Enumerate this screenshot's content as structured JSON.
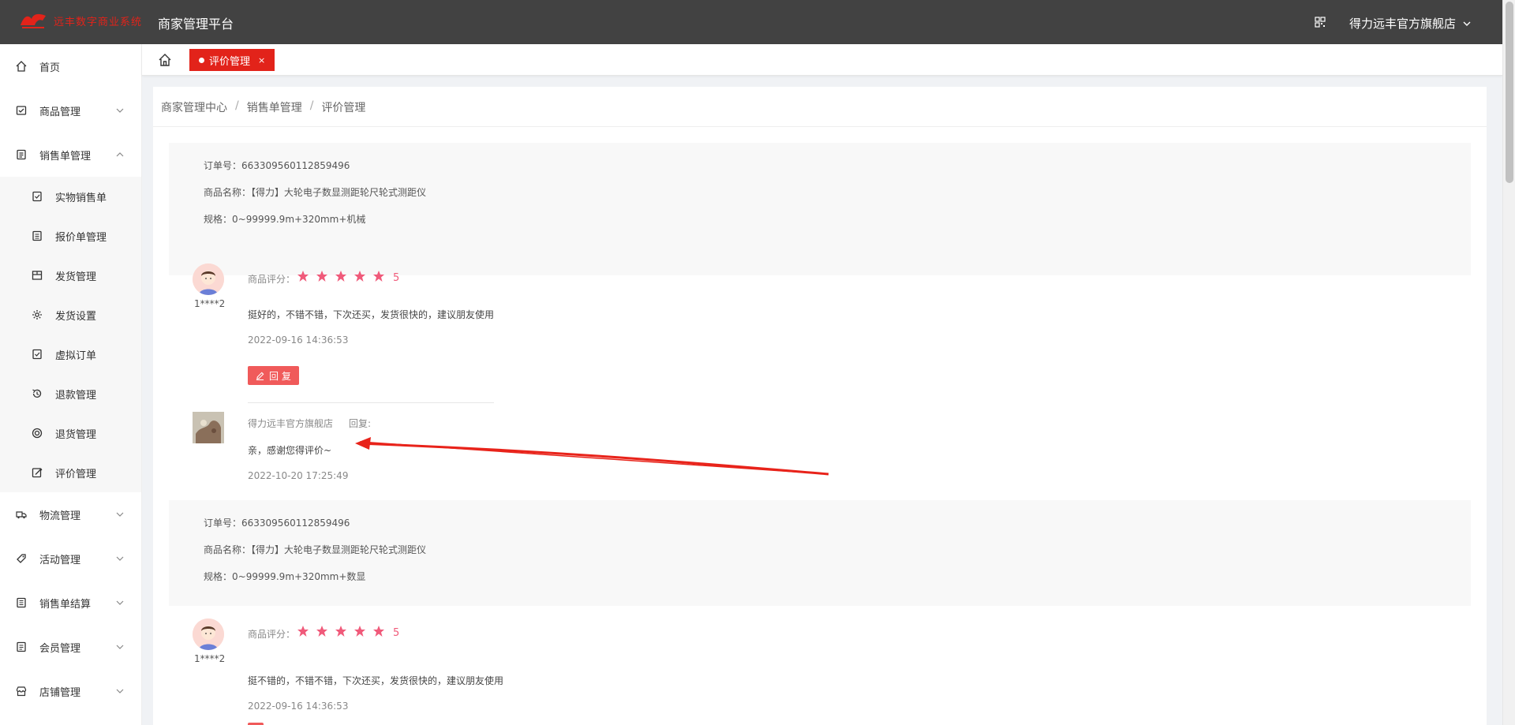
{
  "header": {
    "logo_text": "远丰数字商业系统",
    "platform_title": "商家管理平台",
    "store_name": "得力远丰官方旗舰店"
  },
  "sidebar": {
    "items": [
      {
        "label": "首页",
        "icon": "home-icon"
      },
      {
        "label": "商品管理",
        "icon": "goods-icon",
        "expanded": false
      },
      {
        "label": "销售单管理",
        "icon": "sales-order-icon",
        "expanded": true
      },
      {
        "label": "物流管理",
        "icon": "logistics-icon",
        "expanded": false
      },
      {
        "label": "活动管理",
        "icon": "activity-icon",
        "expanded": false
      },
      {
        "label": "销售单结算",
        "icon": "settlement-icon",
        "expanded": false
      },
      {
        "label": "会员管理",
        "icon": "member-icon",
        "expanded": false
      },
      {
        "label": "店铺管理",
        "icon": "shop-icon",
        "expanded": false
      }
    ],
    "subitems": [
      {
        "label": "实物销售单",
        "icon": "physical-order-icon"
      },
      {
        "label": "报价单管理",
        "icon": "quotation-icon"
      },
      {
        "label": "发货管理",
        "icon": "shipping-icon"
      },
      {
        "label": "发货设置",
        "icon": "gear-icon"
      },
      {
        "label": "虚拟订单",
        "icon": "virtual-order-icon"
      },
      {
        "label": "退款管理",
        "icon": "refund-icon"
      },
      {
        "label": "退货管理",
        "icon": "return-icon"
      },
      {
        "label": "评价管理",
        "icon": "review-icon"
      }
    ]
  },
  "tabs": {
    "active_label": "评价管理",
    "close_glyph": "×"
  },
  "breadcrumb": {
    "items": [
      "商家管理中心",
      "销售单管理",
      "评价管理"
    ],
    "separator": "/"
  },
  "orders": [
    {
      "order_no": "订单号：663309560112859496",
      "product_name": "商品名称：【得力】大轮电子数显测距轮尺轮式测距仪",
      "spec": "规格：0~99999.9m+320mm+机械",
      "review": {
        "username": "1****2",
        "rating_label": "商品评分：",
        "rating": 5,
        "score_text": "5",
        "text": "挺好的，不错不错，下次还买，发货很快的，建议朋友使用",
        "time": "2022-09-16 14:36:53",
        "reply_button": "回 复"
      },
      "reply": {
        "store": "得力远丰官方旗舰店",
        "label": "回复:",
        "text": "亲，感谢您得评价~",
        "time": "2022-10-20 17:25:49"
      }
    },
    {
      "order_no": "订单号：663309560112859496",
      "product_name": "商品名称：【得力】大轮电子数显测距轮尺轮式测距仪",
      "spec": "规格：0~99999.9m+320mm+数显",
      "review": {
        "username": "1****2",
        "rating_label": "商品评分：",
        "rating": 5,
        "score_text": "5",
        "text": "挺不错的，不错不错，下次还买，发货很快的，建议朋友使用",
        "time": "2022-09-16 14:36:53"
      }
    }
  ],
  "colors": {
    "brand_red": "#e2231a",
    "star_pink": "#f05a7a",
    "reply_button": "#f05a5a",
    "header_bg": "#424242"
  }
}
